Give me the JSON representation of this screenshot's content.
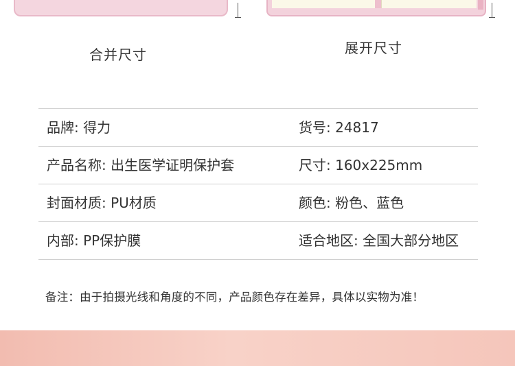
{
  "product_images": {
    "closed": {
      "caption": "合并尺寸"
    },
    "open": {
      "caption": "展开尺寸"
    }
  },
  "specs": [
    {
      "left": "品牌: 得力",
      "right": "货号: 24817"
    },
    {
      "left": "产品名称: 出生医学证明保护套",
      "right": "尺寸: 160x225mm"
    },
    {
      "left": "封面材质: PU材质",
      "right": "颜色: 粉色、蓝色"
    },
    {
      "left": "内部: PP保护膜",
      "right": "适合地区: 全国大部分地区"
    }
  ],
  "note": "备注：由于拍摄光线和角度的不同，产品颜色存在差异，具体以实物为准！",
  "colors": {
    "pink_cover": "#f4d6df",
    "inner_page": "#fbf8e8",
    "bottom_band": "#f5c6bb",
    "divider": "#cfcfcf"
  }
}
